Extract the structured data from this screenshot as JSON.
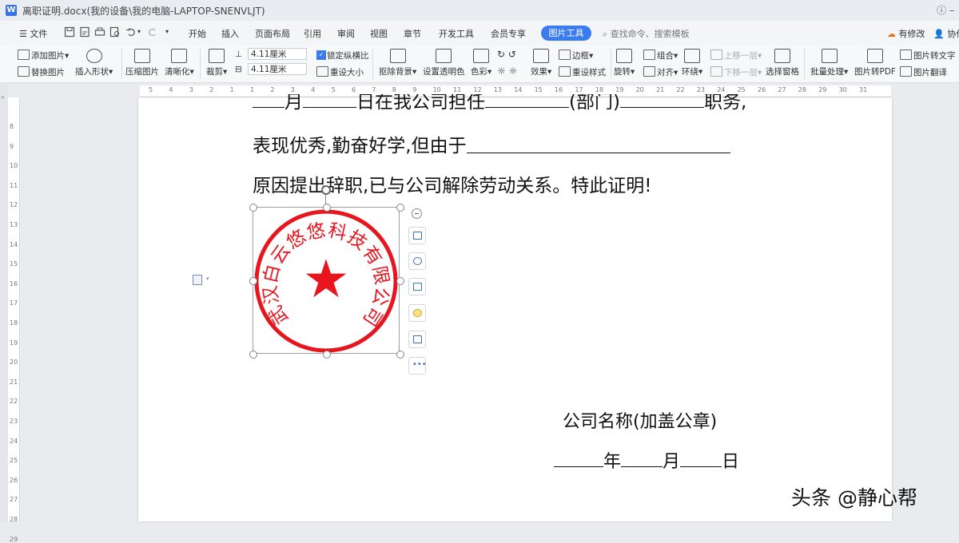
{
  "window": {
    "title": "离职证明.docx(我的设备\\我的电脑-LAPTOP-SNENVLJT)",
    "app_icon": "W",
    "right_icons": "ⓘ  –"
  },
  "menubar": {
    "file_label": "文件",
    "tabs": [
      "开始",
      "插入",
      "页面布局",
      "引用",
      "审阅",
      "视图",
      "章节",
      "开发工具",
      "会员专享"
    ],
    "active_tab": "图片工具",
    "search_placeholder": "查找命令、搜索模板",
    "revise_label": "有修改",
    "collab_label": "协作"
  },
  "toolbar": {
    "add_picture": "添加图片",
    "replace_picture": "替换图片",
    "insert_shape": "插入形状",
    "compress_picture": "压缩图片",
    "sharpen": "清晰化",
    "crop": "裁剪",
    "width_value": "4.11厘米",
    "height_value": "4.11厘米",
    "lock_ratio": "锁定纵横比",
    "reset_size": "重设大小",
    "remove_bg": "抠除背景",
    "set_transparent": "设置透明色",
    "color": "色彩",
    "effects": "效果",
    "border": "边框",
    "reset_style": "重设样式",
    "rotate": "旋转",
    "group": "组合",
    "align": "对齐",
    "wrap": "环绕",
    "bring_forward": "上移一层",
    "send_backward": "下移一层",
    "selection_pane": "选择窗格",
    "batch_process": "批量处理",
    "to_pdf": "图片转PDF",
    "to_text": "图片转文字",
    "translate": "图片翻译"
  },
  "ruler_h": [
    "5",
    "4",
    "3",
    "2",
    "1",
    "1",
    "2",
    "3",
    "4",
    "5",
    "6",
    "7",
    "8",
    "9",
    "10",
    "11",
    "12",
    "13",
    "14",
    "15",
    "16",
    "17",
    "18",
    "19",
    "20",
    "21",
    "22",
    "23",
    "24",
    "25",
    "26",
    "27",
    "28",
    "29",
    "30",
    "31"
  ],
  "ruler_v": [
    "8",
    "9",
    "10",
    "11",
    "12",
    "13",
    "14",
    "15",
    "16",
    "17",
    "18",
    "19",
    "20",
    "21",
    "22",
    "23",
    "24",
    "25",
    "26",
    "27",
    "28",
    "29"
  ],
  "document": {
    "line1_a": "月",
    "line1_b": "日在我公司担任",
    "line1_c": "(部门)",
    "line1_d": "职务,",
    "line2": "表现优秀,勤奋好学,但由于",
    "line3": "原因提出辞职,已与公司解除劳动关系。特此证明!",
    "company_label": "公司名称(加盖公章)",
    "date_year": "年",
    "date_month": "月",
    "date_day": "日"
  },
  "seal": {
    "company_name": "武汉白云悠悠科技有限公司",
    "star": "★",
    "color": "#e8141e"
  },
  "watermark": "头条 @静心帮"
}
